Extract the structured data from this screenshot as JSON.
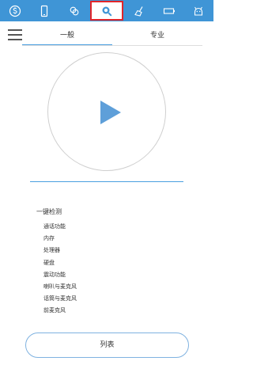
{
  "topbar": {
    "bg_color": "#3f95d6",
    "active_border_color": "#e0252a",
    "items": [
      {
        "icon": "dollar-circle-icon"
      },
      {
        "icon": "phone-icon"
      },
      {
        "icon": "apps-icon"
      },
      {
        "icon": "search-icon",
        "active": true
      },
      {
        "icon": "broom-icon"
      },
      {
        "icon": "battery-icon"
      },
      {
        "icon": "android-icon"
      }
    ]
  },
  "tabs": [
    {
      "label": "一般",
      "active": true
    },
    {
      "label": "专业",
      "active": false
    }
  ],
  "accent_color": "#4a9fe0",
  "check": {
    "title": "一键检测",
    "items": [
      "通话功能",
      "内存",
      "处理器",
      "硬盘",
      "震动功能",
      "喇叭与麦克风",
      "话筒与麦克风",
      "前麦克风"
    ]
  },
  "list_button": {
    "label": "列表"
  }
}
